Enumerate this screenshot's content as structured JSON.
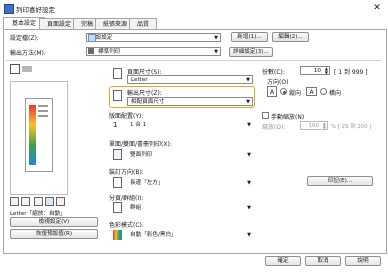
{
  "window": {
    "title": "列印喜好設定",
    "close_glyph": "✕"
  },
  "tabs": [
    "基本設定",
    "頁面設定",
    "完稿",
    "紙張來源",
    "品質"
  ],
  "profile": {
    "label": "設定檔(Z):",
    "value": "預設設定",
    "add_label": "新增(1)...",
    "edit_label": "編輯(2)..."
  },
  "output": {
    "label": "輸出方法(M):",
    "value": "標準列印",
    "details_label": "詳細設定(3)..."
  },
  "page_size": {
    "label": "頁面尺寸(S):",
    "value": "Letter"
  },
  "output_size": {
    "label": "輸出尺寸(Z):",
    "value": "相配頁面尺寸"
  },
  "nup": {
    "label": "版面配置(Y):",
    "value": "1 合 1"
  },
  "duplex": {
    "label": "單面/雙面/書冊列印(X):",
    "value": "雙面列印"
  },
  "binding": {
    "label": "裝訂方向(B):",
    "value": "長邊「左方」"
  },
  "finishing": {
    "label": "分頁/群組(I):",
    "value": "群組"
  },
  "color": {
    "label": "色彩模式(C):",
    "value": "自動「彩色/黑白」"
  },
  "copies": {
    "label": "份數(C):",
    "value": "10",
    "range": "[ 1 到 999 ]"
  },
  "orientation": {
    "label": "方向(O)",
    "portrait": "縱向",
    "landscape": "橫向",
    "selected": "portrait"
  },
  "manual_scaling": {
    "label": "手動縮放(N)",
    "checked": false
  },
  "scale": {
    "label": "縮放(O):",
    "value": "100",
    "range": "% [ 25 到 200 ]"
  },
  "preview": {
    "caption": "Letter「縮放：自動」",
    "view_settings_label": "檢視設定(V)",
    "restore_defaults_label": "恢復預設值(R)"
  },
  "stamp": {
    "label": "印記(E)..."
  },
  "footer": {
    "ok": "確定",
    "cancel": "取消",
    "help": "說明"
  }
}
